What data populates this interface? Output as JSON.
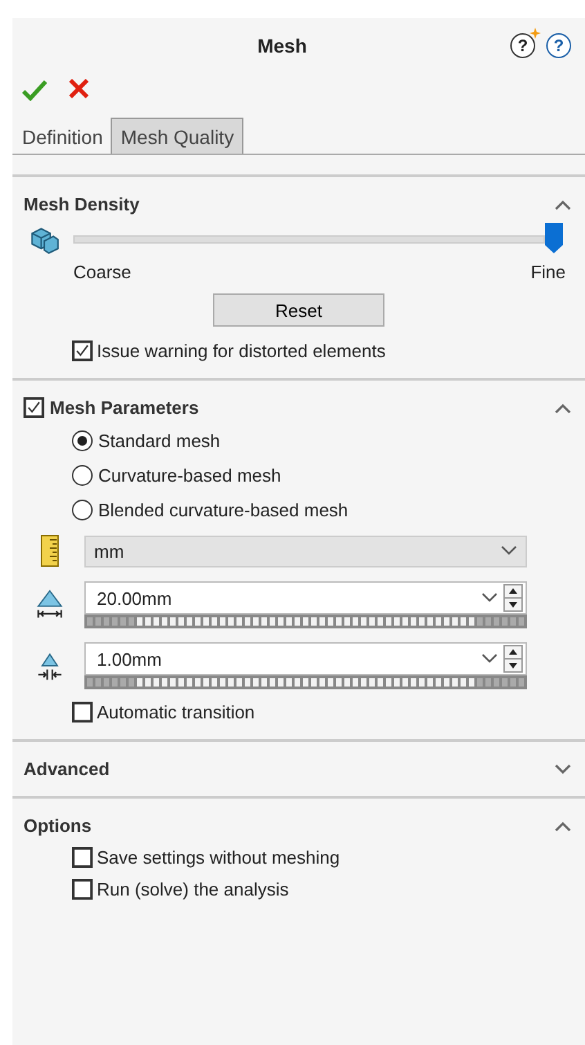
{
  "title": "Mesh",
  "help": [
    {
      "symbol": "?",
      "star": true
    },
    {
      "symbol": "?",
      "star": false
    }
  ],
  "tabs": [
    {
      "label": "Definition",
      "selected": true
    },
    {
      "label": "Mesh Quality",
      "selected": false
    }
  ],
  "mesh_density": {
    "title": "Mesh Density",
    "expanded": true,
    "slider": {
      "level": 1,
      "min_label": "Coarse",
      "max_label": "Fine"
    },
    "reset_button": "Reset",
    "warning_checkbox": {
      "label": "Issue warning for distorted elements",
      "checked": true
    }
  },
  "mesh_parameters": {
    "title": "Mesh Parameters",
    "checked": true,
    "expanded": true,
    "options": [
      {
        "label": "Standard mesh",
        "selected": true
      },
      {
        "label": "Curvature-based mesh",
        "selected": false
      },
      {
        "label": "Blended curvature-based mesh",
        "selected": false
      }
    ],
    "unit": {
      "value": "mm"
    },
    "size_fields": [
      {
        "value": "20.00mm"
      },
      {
        "value": "1.00mm"
      }
    ],
    "automatic_transition": {
      "label": "Automatic transition",
      "checked": false
    }
  },
  "advanced": {
    "title": "Advanced",
    "expanded": false
  },
  "options": {
    "title": "Options",
    "expanded": true,
    "checkboxes": [
      {
        "label": "Save settings without meshing",
        "checked": false
      },
      {
        "label": "Run (solve) the analysis",
        "checked": false
      }
    ]
  }
}
